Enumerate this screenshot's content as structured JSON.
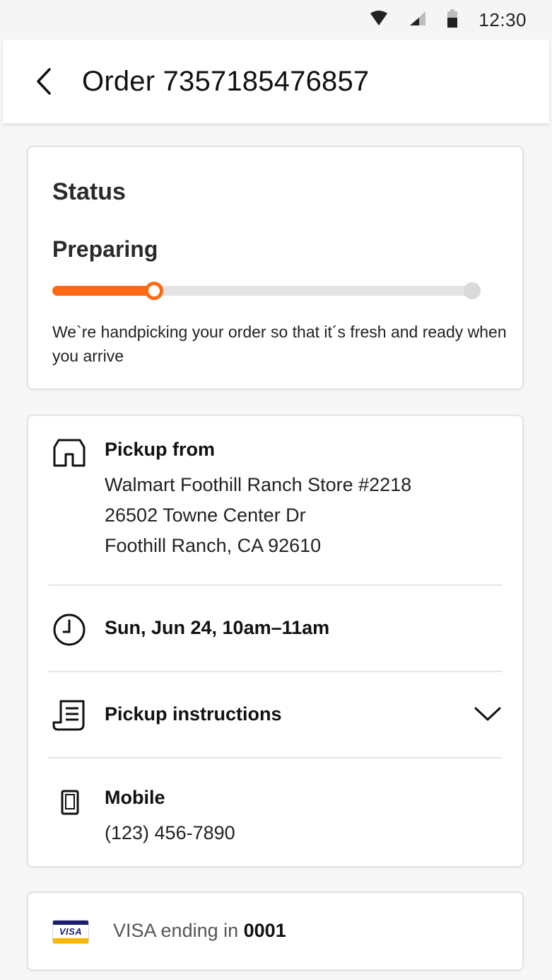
{
  "status_bar": {
    "time": "12:30",
    "icons": [
      "wifi-icon",
      "cell-signal-icon",
      "battery-icon"
    ]
  },
  "header": {
    "back_icon": "chevron-left-icon",
    "title": "Order 7357185476857"
  },
  "status_card": {
    "heading": "Status",
    "value": "Preparing",
    "progress": 0.24,
    "progress_color": "#ff6a13",
    "description": "We`re handpicking your order so that it´s fresh and ready when you arrive"
  },
  "pickup": {
    "icon": "store-icon",
    "title": "Pickup from",
    "store_name": "Walmart Foothill Ranch Store #2218",
    "address_line1": "26502 Towne Center Dr",
    "address_line2": "Foothill Ranch, CA 92610"
  },
  "time_slot": {
    "icon": "clock-icon",
    "label": "Sun, Jun 24, 10am–11am"
  },
  "instructions": {
    "icon": "receipt-icon",
    "label": "Pickup instructions",
    "toggle_icon": "chevron-down-icon"
  },
  "mobile": {
    "icon": "phone-icon",
    "title": "Mobile",
    "number": "(123) 456-7890"
  },
  "payment": {
    "card_icon": "visa-card-icon",
    "card_brand_text": "VISA",
    "prefix": "VISA ending in ",
    "last4": "0001"
  }
}
